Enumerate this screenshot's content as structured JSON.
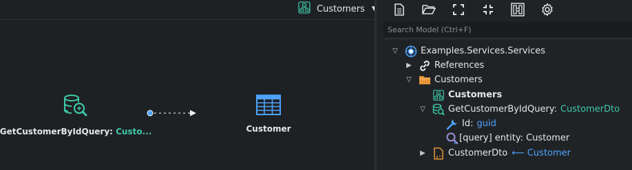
{
  "diagram": {
    "selector_label": "Customers",
    "selector_icon": "diagram-icon",
    "nodes": {
      "query_name": "GetCustomerByIdQuery:",
      "query_type": "Custo...",
      "entity_name": "Customer"
    }
  },
  "toolbar": {
    "buttons": [
      "document-icon",
      "open-folder-icon",
      "expand-icon",
      "collapse-icon",
      "designer-icon",
      "settings-icon"
    ]
  },
  "search": {
    "placeholder": "Search Model (Ctrl+F)",
    "value": ""
  },
  "tree": {
    "root": {
      "label": "Examples.Services.Services",
      "icon": "service-package-icon"
    },
    "references": {
      "label": "References",
      "icon": "link-icon"
    },
    "folder": {
      "label": "Customers",
      "icon": "folder-icon"
    },
    "diagram_item": {
      "label": "Customers",
      "icon": "diagram-icon"
    },
    "query": {
      "label": "GetCustomerByIdQuery:",
      "type": "CustomerDto",
      "icon": "query-icon"
    },
    "id_prop": {
      "label": "Id:",
      "type": "guid",
      "icon": "wrench-icon"
    },
    "query_entity": {
      "label": "[query] entity: Customer",
      "icon": "magnifier-icon"
    },
    "dto": {
      "label": "CustomerDto",
      "mapped_from": "Customer",
      "icon": "dto-icon"
    }
  },
  "colors": {
    "accent_green": "#3ec9a8",
    "accent_blue": "#4da3ff",
    "folder_orange": "#e8953a"
  }
}
